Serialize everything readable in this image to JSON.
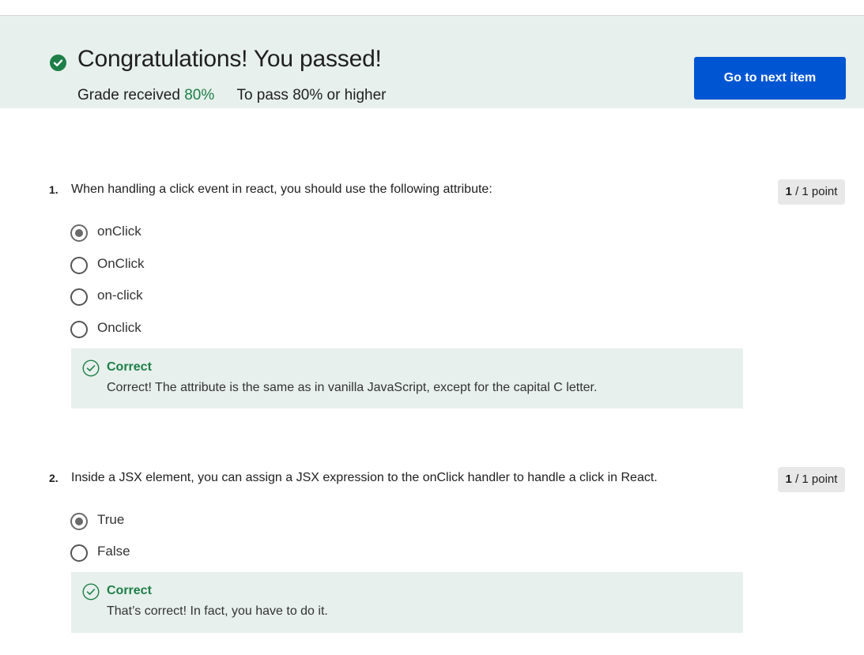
{
  "banner": {
    "title": "Congratulations! You passed!",
    "grade_label": "Grade received",
    "grade_value": "80%",
    "pass_label": "To pass",
    "pass_value": "80% or higher",
    "next_button": "Go to next item"
  },
  "questions": [
    {
      "number": "1.",
      "text": "When handling a click event in react, you should use the following attribute:",
      "points_earned": "1",
      "points_rest": "/ 1 point",
      "options": [
        {
          "label": "onClick",
          "selected": true
        },
        {
          "label": "OnClick",
          "selected": false
        },
        {
          "label": "on-click",
          "selected": false
        },
        {
          "label": "Onclick",
          "selected": false
        }
      ],
      "feedback": {
        "title": "Correct",
        "text": "Correct! The attribute is the same as in vanilla JavaScript, except for the capital C letter."
      }
    },
    {
      "number": "2.",
      "text": "Inside a JSX element, you can assign a JSX expression to the onClick handler to handle a click in React.",
      "points_earned": "1",
      "points_rest": "/ 1 point",
      "options": [
        {
          "label": "True",
          "selected": true
        },
        {
          "label": "False",
          "selected": false
        }
      ],
      "feedback": {
        "title": "Correct",
        "text": "That’s correct! In fact, you have to do it."
      }
    }
  ],
  "colors": {
    "accent_green": "#1e7f48",
    "primary_blue": "#0056d2",
    "banner_bg": "#e7f0ec"
  }
}
